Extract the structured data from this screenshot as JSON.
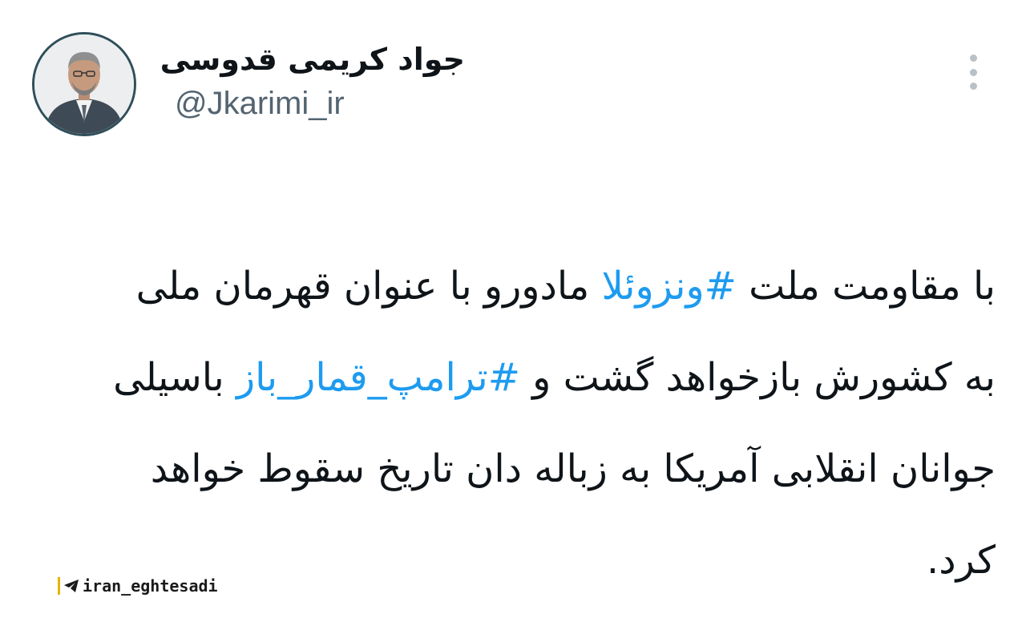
{
  "author": {
    "display_name": "جواد کریمی قدوسی",
    "handle": "@Jkarimi_ir",
    "avatar_icon": "profile-photo"
  },
  "menu": {
    "more_icon": "more-vertical-icon"
  },
  "tweet": {
    "line1": {
      "a": "با مقاومت ملت ",
      "tag": "#ونزوئلا",
      "b": " مادورو با عنوان قهرمان ملی"
    },
    "line2": {
      "a": "به کشورش بازخواهد گشت و ",
      "tag": "#ترامپ_قمار_باز",
      "b": " باسیلی"
    },
    "line3": "جوانان انقلابی آمریکا به زباله دان تاریخ سقوط خواهد",
    "line4": "کرد."
  },
  "watermark": {
    "text": "iran_eghtesadi",
    "icon": "telegram-icon"
  },
  "colors": {
    "hashtag": "#1d9bf0",
    "handle": "#536471",
    "text": "#0f1419"
  }
}
